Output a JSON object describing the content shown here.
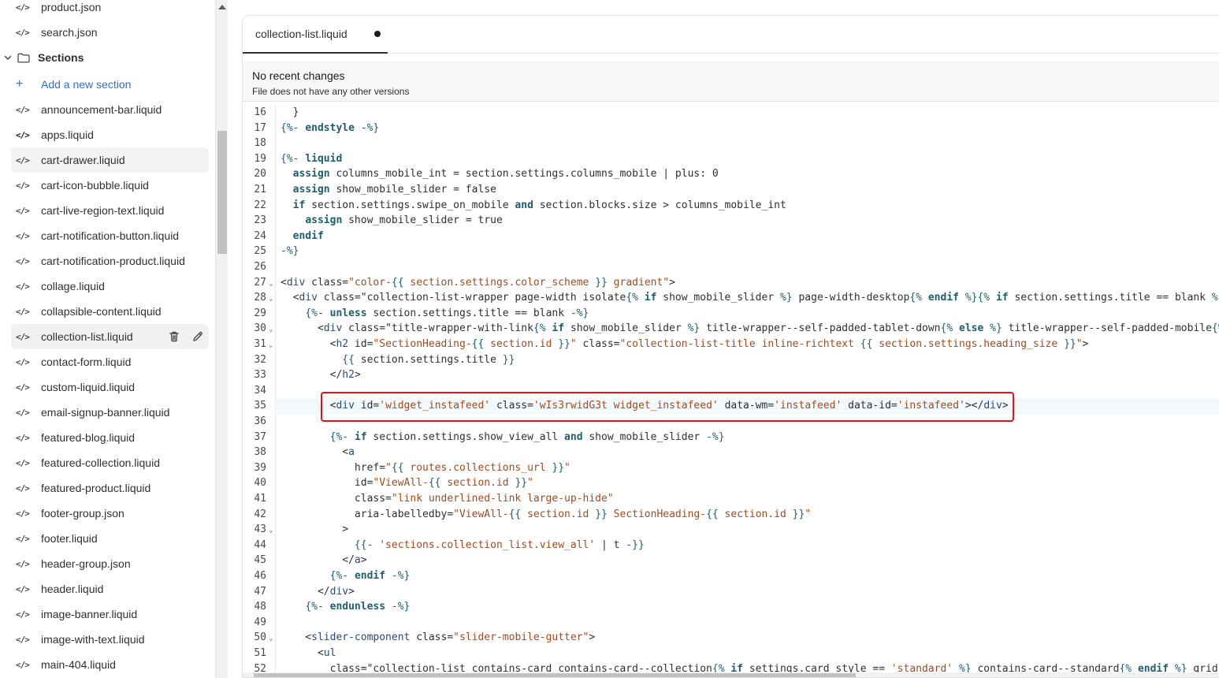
{
  "sidebar": {
    "files_top": [
      "product.json",
      "search.json"
    ],
    "section_label": "Sections",
    "add_section_label": "Add a new section",
    "section_files": [
      "announcement-bar.liquid",
      "apps.liquid",
      "cart-drawer.liquid",
      "cart-icon-bubble.liquid",
      "cart-live-region-text.liquid",
      "cart-notification-button.liquid",
      "cart-notification-product.liquid",
      "collage.liquid",
      "collapsible-content.liquid",
      "collection-list.liquid",
      "contact-form.liquid",
      "custom-liquid.liquid",
      "email-signup-banner.liquid",
      "featured-blog.liquid",
      "featured-collection.liquid",
      "featured-product.liquid",
      "footer-group.json",
      "footer.liquid",
      "header-group.json",
      "header.liquid",
      "image-banner.liquid",
      "image-with-text.liquid",
      "main-404.liquid"
    ],
    "selected_file": "collection-list.liquid",
    "icons": {
      "file": "code-file-icon",
      "delete": "trash-icon",
      "rename": "pencil-icon",
      "folder": "folder-icon",
      "expand": "chevron-down-icon",
      "add": "plus-icon"
    }
  },
  "editor": {
    "tab_label": "collection-list.liquid",
    "unsaved_indicator": "unsaved-dot",
    "banner_title": "No recent changes",
    "banner_subtitle": "File does not have any other versions",
    "highlight_color": "#e0131c",
    "lines": [
      {
        "n": "16",
        "t": "  }"
      },
      {
        "n": "17",
        "t": "{%- endstyle -%}"
      },
      {
        "n": "18",
        "t": ""
      },
      {
        "n": "19",
        "t": "{%- liquid"
      },
      {
        "n": "20",
        "t": "  assign columns_mobile_int = section.settings.columns_mobile | plus: 0"
      },
      {
        "n": "21",
        "t": "  assign show_mobile_slider = false"
      },
      {
        "n": "22",
        "t": "  if section.settings.swipe_on_mobile and section.blocks.size > columns_mobile_int"
      },
      {
        "n": "23",
        "t": "    assign show_mobile_slider = true"
      },
      {
        "n": "24",
        "t": "  endif"
      },
      {
        "n": "25",
        "t": "-%}"
      },
      {
        "n": "26",
        "t": ""
      },
      {
        "n": "27",
        "t": "<div class=\"color-{{ section.settings.color_scheme }} gradient\">"
      },
      {
        "n": "28",
        "t": "  <div class=\"collection-list-wrapper page-width isolate{% if show_mobile_slider %} page-width-desktop{% endif %}{% if section.settings.title == blank %} n"
      },
      {
        "n": "29",
        "t": "    {%- unless section.settings.title == blank -%}"
      },
      {
        "n": "30",
        "t": "      <div class=\"title-wrapper-with-link{% if show_mobile_slider %} title-wrapper--self-padded-tablet-down{% else %} title-wrapper--self-padded-mobile{% e"
      },
      {
        "n": "31",
        "t": "        <h2 id=\"SectionHeading-{{ section.id }}\" class=\"collection-list-title inline-richtext {{ section.settings.heading_size }}\">"
      },
      {
        "n": "32",
        "t": "          {{ section.settings.title }}"
      },
      {
        "n": "33",
        "t": "        </h2>"
      },
      {
        "n": "34",
        "t": ""
      },
      {
        "n": "35",
        "t": "        <div id='widget_instafeed' class='wIs3rwidG3t widget_instafeed' data-wm='instafeed' data-id='instafeed'></div>"
      },
      {
        "n": "36",
        "t": ""
      },
      {
        "n": "37",
        "t": "        {%- if section.settings.show_view_all and show_mobile_slider -%}"
      },
      {
        "n": "38",
        "t": "          <a"
      },
      {
        "n": "39",
        "t": "            href=\"{{ routes.collections_url }}\""
      },
      {
        "n": "40",
        "t": "            id=\"ViewAll-{{ section.id }}\""
      },
      {
        "n": "41",
        "t": "            class=\"link underlined-link large-up-hide\""
      },
      {
        "n": "42",
        "t": "            aria-labelledby=\"ViewAll-{{ section.id }} SectionHeading-{{ section.id }}\""
      },
      {
        "n": "43",
        "t": "          >"
      },
      {
        "n": "44",
        "t": "            {{- 'sections.collection_list.view_all' | t -}}"
      },
      {
        "n": "45",
        "t": "          </a>"
      },
      {
        "n": "46",
        "t": "        {%- endif -%}"
      },
      {
        "n": "47",
        "t": "      </div>"
      },
      {
        "n": "48",
        "t": "    {%- endunless -%}"
      },
      {
        "n": "49",
        "t": ""
      },
      {
        "n": "50",
        "t": "    <slider-component class=\"slider-mobile-gutter\">"
      },
      {
        "n": "51",
        "t": "      <ul"
      },
      {
        "n": "52",
        "t": "        class=\"collection-list contains-card contains-card--collection{% if settings.card_style == 'standard' %} contains-card--standard{% endif %} grid gr"
      }
    ],
    "foldable_lines": [
      "27",
      "28",
      "30",
      "31",
      "43",
      "50"
    ],
    "highlighted_line": "35"
  }
}
